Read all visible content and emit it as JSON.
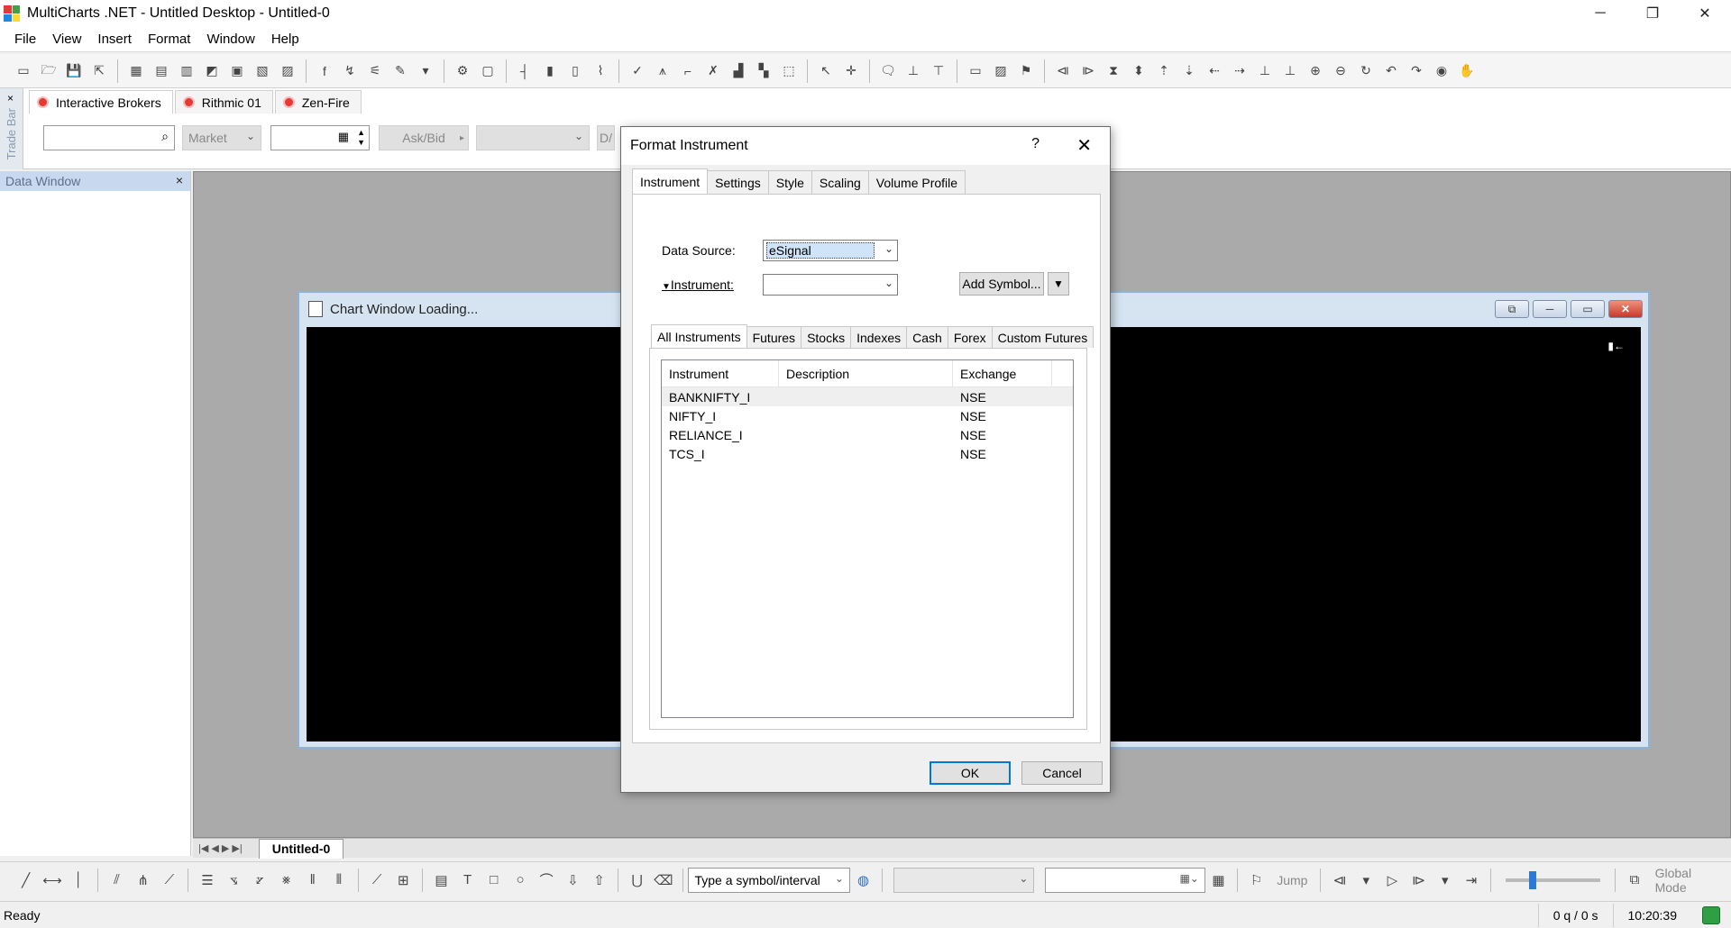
{
  "app": {
    "title": "MultiCharts .NET - Untitled Desktop - Untitled-0",
    "min": "─",
    "restore": "❐",
    "close": "✕"
  },
  "menu": [
    "File",
    "View",
    "Insert",
    "Format",
    "Window",
    "Help"
  ],
  "tradebar": {
    "side_label": "Trade Bar",
    "close": "×",
    "brokers": [
      "Interactive Brokers",
      "Rithmic 01",
      "Zen-Fire"
    ],
    "order_type": "Market",
    "price_mode": "Ask/Bid",
    "partial": "D/"
  },
  "data_window": {
    "title": "Data Window",
    "close": "×"
  },
  "chart_window": {
    "title": "Chart Window Loading...",
    "panel_toggle": "▮←"
  },
  "sheet_tabs": {
    "nav": "|◀ ◀ ▶ ▶|",
    "active": "Untitled-0"
  },
  "drawbar": {
    "symbol_placeholder": "Type a symbol/interval",
    "jump": "Jump",
    "global_mode": "Global Mode"
  },
  "status": {
    "left": "Ready",
    "queue": "0 q / 0 s",
    "time": "10:20:39"
  },
  "dialog": {
    "title": "Format Instrument",
    "help": "?",
    "close": "✕",
    "tabs": [
      "Instrument",
      "Settings",
      "Style",
      "Scaling",
      "Volume Profile"
    ],
    "data_source_label": "Data Source:",
    "data_source_value": "eSignal",
    "instrument_label": "Instrument:",
    "instrument_value": "",
    "add_symbol": "Add Symbol...",
    "inst_tabs": [
      "All Instruments",
      "Futures",
      "Stocks",
      "Indexes",
      "Cash",
      "Forex",
      "Custom Futures"
    ],
    "columns": [
      "Instrument",
      "Description",
      "Exchange"
    ],
    "rows": [
      {
        "instrument": "BANKNIFTY_I",
        "description": "",
        "exchange": "NSE"
      },
      {
        "instrument": "NIFTY_I",
        "description": "",
        "exchange": "NSE"
      },
      {
        "instrument": "RELIANCE_I",
        "description": "",
        "exchange": "NSE"
      },
      {
        "instrument": "TCS_I",
        "description": "",
        "exchange": "NSE"
      }
    ],
    "ok": "OK",
    "cancel": "Cancel"
  }
}
